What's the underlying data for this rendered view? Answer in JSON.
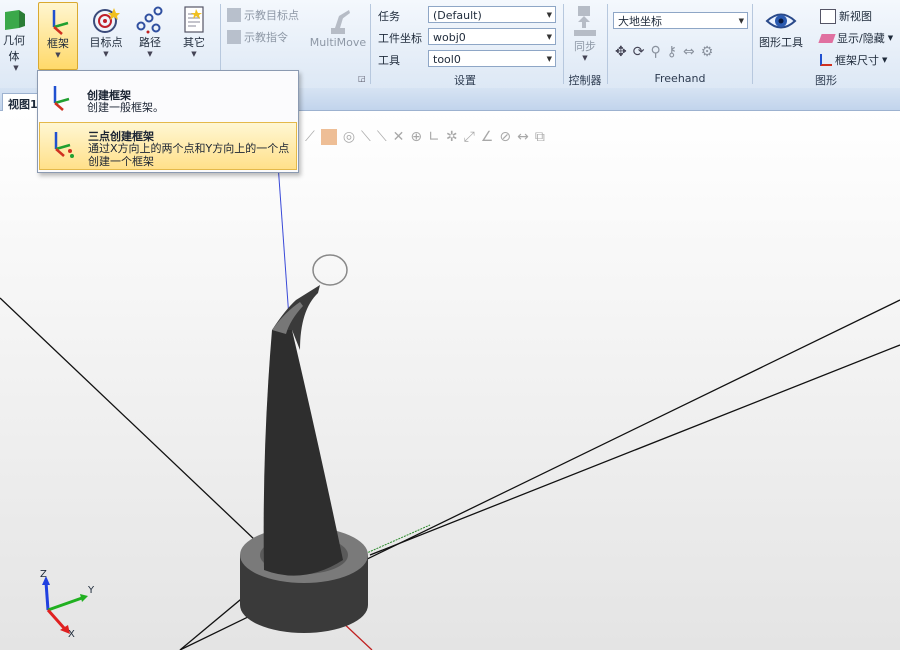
{
  "ribbon": {
    "geometry_label": "几何体",
    "frame_label": "框架",
    "target_label": "目标点",
    "path_label": "路径",
    "other_label": "其它",
    "teach_target": "示教目标点",
    "teach_instruction": "示教指令",
    "multimove": "MultiMove",
    "settings": {
      "task_label": "任务",
      "task_value": "(Default)",
      "workobj_label": "工件坐标",
      "workobj_value": "wobj0",
      "tool_label": "工具",
      "tool_value": "tool0",
      "group_label": "设置"
    },
    "sync_label": "同步",
    "controller_group": "控制器",
    "freehand_combo": "大地坐标",
    "freehand_group": "Freehand",
    "graphics_tools": "图形工具",
    "new_view": "新视图",
    "show_hide": "显示/隐藏",
    "frame_size": "框架尺寸",
    "graphics_group": "图形"
  },
  "view_tab": "视图1",
  "dropdown": {
    "items": [
      {
        "title": "创建框架",
        "desc": "创建一般框架。"
      },
      {
        "title": "三点创建框架",
        "desc": "通过X方向上的两个点和Y方向上的一个点创建一个框架"
      }
    ]
  },
  "axis_triad": {
    "z": "Z",
    "y": "Y",
    "x": "X"
  },
  "colors": {
    "accent": "#ffd96a",
    "ribbon_bg": "#dde8f5",
    "x_axis": "#e02020",
    "y_axis": "#20b020",
    "z_axis": "#2040e0"
  }
}
